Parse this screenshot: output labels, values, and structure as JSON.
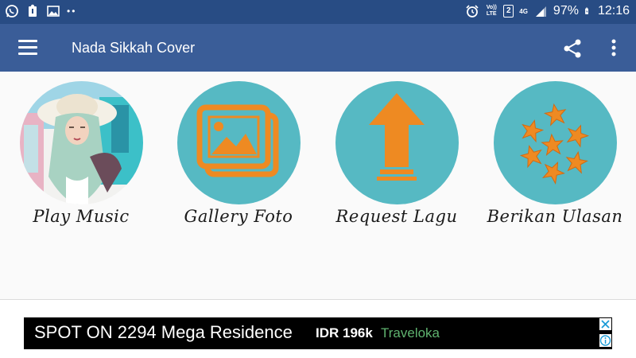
{
  "status_bar": {
    "volte_label": "Vo)) LTE",
    "sim_label": "2",
    "network_label": "4G",
    "battery_text": "97%",
    "clock": "12:16",
    "icons": [
      "whatsapp-icon",
      "notification-icon",
      "image-icon",
      "alarm-icon",
      "signal-icon",
      "battery-icon"
    ]
  },
  "app_bar": {
    "title": "Nada Sikkah Cover",
    "icons": [
      "menu-icon",
      "share-icon",
      "more-vert-icon"
    ]
  },
  "tiles": [
    {
      "label": "Play Music",
      "icon": "photo-avatar"
    },
    {
      "label": "Gallery Foto",
      "icon": "gallery-icon"
    },
    {
      "label": "Request Lagu",
      "icon": "upload-arrow-icon"
    },
    {
      "label": "Berikan Ulasan",
      "icon": "stars-icon"
    }
  ],
  "ad": {
    "title": "SPOT ON 2294 Mega Residence",
    "price": "IDR 196k",
    "brand": "Traveloka",
    "icons": [
      "close-icon",
      "ad-info-icon"
    ]
  },
  "colors": {
    "status_bar": "#284c84",
    "app_bar": "#3a5d98",
    "teal": "#56b9c3",
    "orange": "#ee8a22",
    "ad_background": "#000000",
    "ad_brand": "#5fb36f"
  }
}
